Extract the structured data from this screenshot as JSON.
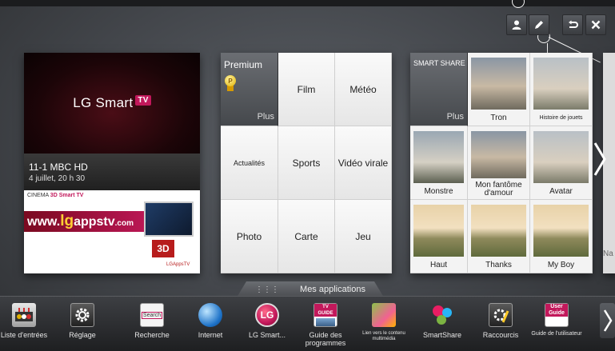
{
  "top_actions": {
    "user_icon": "user-icon",
    "edit_icon": "pencil-icon",
    "back_icon": "return-icon",
    "close_icon": "close-icon"
  },
  "live_card": {
    "logo_text": "LG Smart",
    "logo_badge": "TV",
    "channel": "11-1 MBC HD",
    "date": "4 juillet, 20 h 30",
    "ad_brand_left": "CINEMA",
    "ad_brand_3d": "3D",
    "ad_brand_right": "Smart TV",
    "ad_url_prefix": "www.",
    "ad_url_lg": "lg",
    "ad_url_rest": "appstv",
    "ad_url_suffix": ".com",
    "ad_3d_badge": "3D",
    "ad_footer": "LGAppsTV"
  },
  "premium_card": {
    "title": "Premium",
    "badge": "P",
    "more": "Plus",
    "cells": [
      "Film",
      "Météo",
      "Actualités",
      "Sports",
      "Vidéo virale",
      "Photo",
      "Carte",
      "Jeu"
    ]
  },
  "share_card": {
    "title": "SMART SHARE",
    "more": "Plus",
    "items": [
      "Tron",
      "Histoire de jouets",
      "Monstre",
      "Mon fantôme d'amour",
      "Avatar",
      "Haut",
      "Thanks",
      "My Boy"
    ]
  },
  "dock": {
    "tab_label": "Mes applications",
    "items": [
      {
        "label": "Liste d'entrées",
        "icon": "inputs-icon"
      },
      {
        "label": "Réglage",
        "icon": "gear-icon"
      },
      {
        "label": "Recherche",
        "icon": "search-icon"
      },
      {
        "label": "Internet",
        "icon": "globe-icon"
      },
      {
        "label": "LG Smart...",
        "icon": "lg-icon"
      },
      {
        "label": "Guide des programmes",
        "icon": "tv-guide-icon"
      },
      {
        "label": "Lien vers le contenu multimédia",
        "icon": "media-link-icon"
      },
      {
        "label": "SmartShare",
        "icon": "smartshare-icon"
      },
      {
        "label": "Raccourcis",
        "icon": "shortcuts-icon"
      },
      {
        "label": "Guide de l'utilisateur",
        "icon": "user-guide-icon"
      }
    ],
    "tv_guide_icon_text": "TV GUIDE",
    "user_guide_icon_text": "User Guide",
    "search_icon_text": "Search",
    "lg_icon_text": "LG"
  },
  "partial_card": {
    "peek_label": "Na"
  }
}
